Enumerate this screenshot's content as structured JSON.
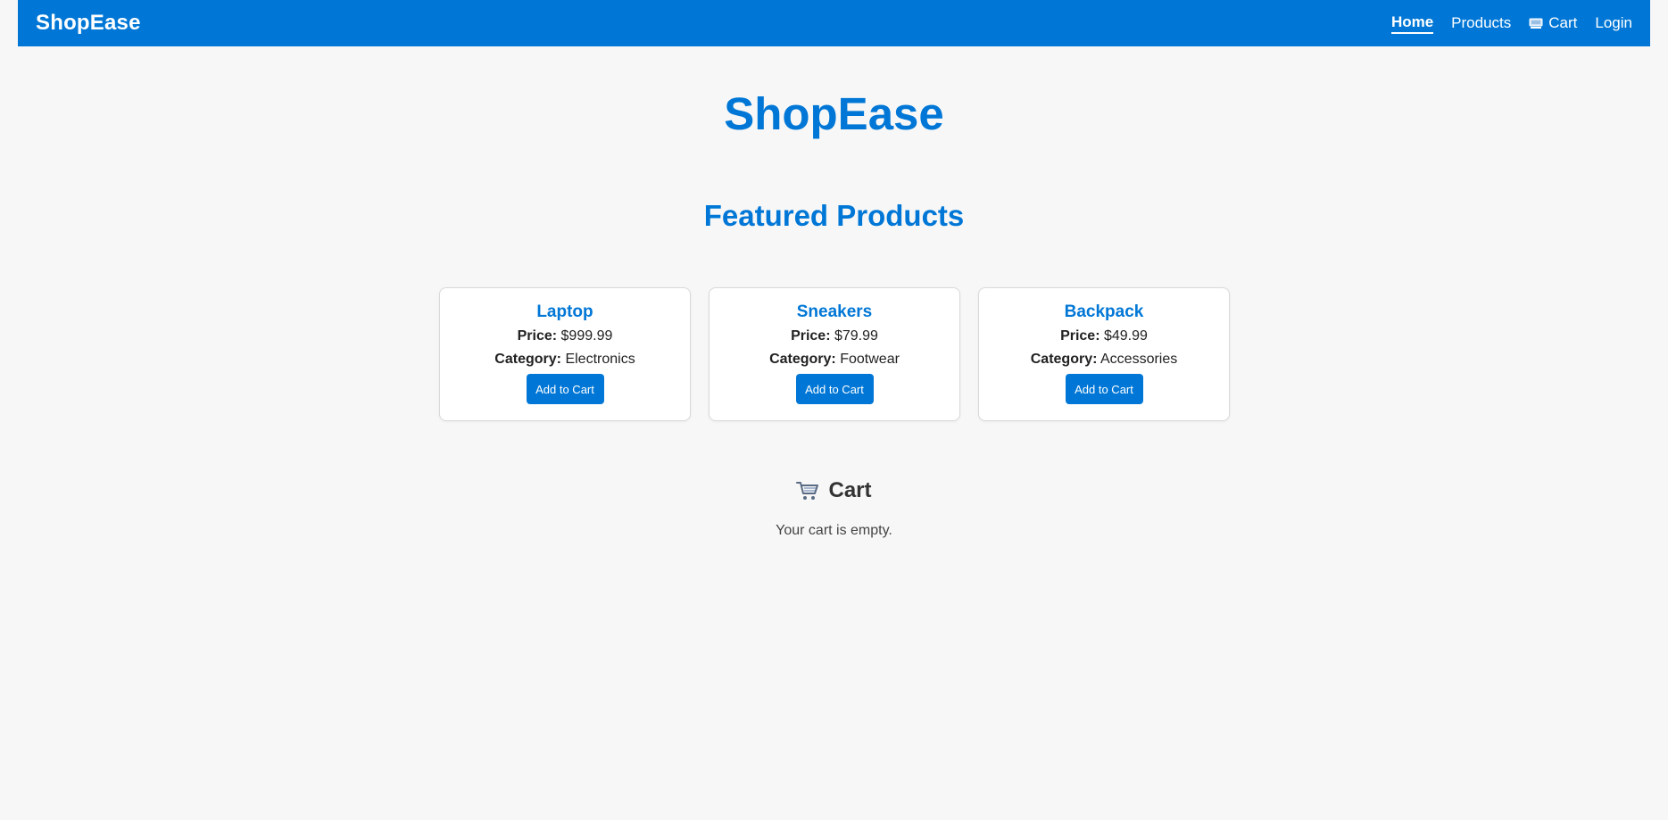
{
  "navbar": {
    "brand": "ShopEase",
    "links": [
      {
        "label": "Home",
        "active": true
      },
      {
        "label": "Products",
        "active": false
      },
      {
        "label": "Cart",
        "active": false,
        "icon": "cart-icon"
      },
      {
        "label": "Login",
        "active": false
      }
    ]
  },
  "main": {
    "title": "ShopEase",
    "featured_title": "Featured Products",
    "products": [
      {
        "name": "Laptop",
        "price_label": "Price:",
        "price": "$999.99",
        "category_label": "Category:",
        "category": "Electronics",
        "button": "Add to Cart"
      },
      {
        "name": "Sneakers",
        "price_label": "Price:",
        "price": "$79.99",
        "category_label": "Category:",
        "category": "Footwear",
        "button": "Add to Cart"
      },
      {
        "name": "Backpack",
        "price_label": "Price:",
        "price": "$49.99",
        "category_label": "Category:",
        "category": "Accessories",
        "button": "Add to Cart"
      }
    ],
    "cart": {
      "icon": "shopping-cart-icon",
      "title": "Cart",
      "empty_message": "Your cart is empty."
    }
  },
  "colors": {
    "primary": "#0077d6",
    "background": "#f7f7f7",
    "card": "#ffffff",
    "text": "#222222"
  }
}
